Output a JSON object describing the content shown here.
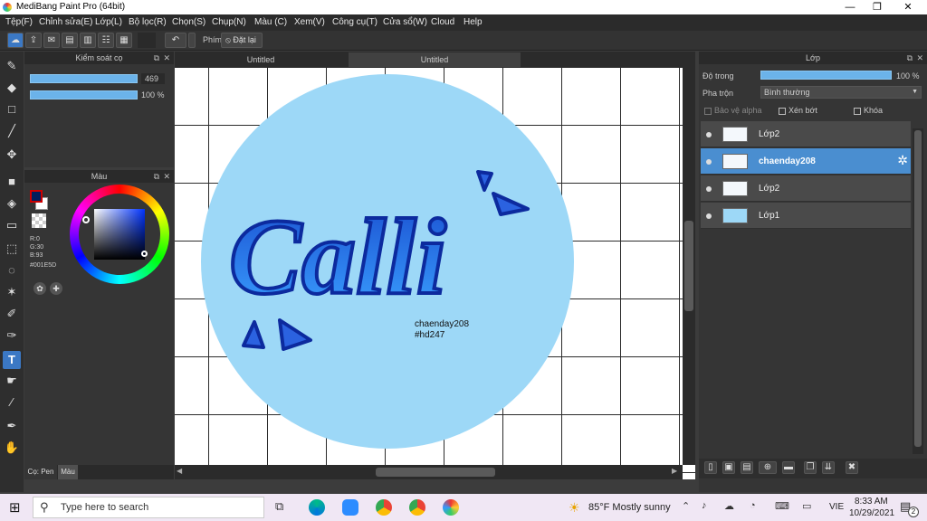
{
  "window": {
    "title": "MediBang Paint Pro (64bit)",
    "min": "—",
    "max": "❐",
    "close": "✕"
  },
  "menu": [
    "Tệp(F)",
    "Chỉnh sửa(E)",
    "Lớp(L)",
    "Bộ lọc(R)",
    "Chọn(S)",
    "Chụp(N)",
    "Màu (C)",
    "Xem(V)",
    "Công cụ(T)",
    "Cửa sổ(W)",
    "Cloud",
    "Help"
  ],
  "toolbar": {
    "key_label": "Phím",
    "reset_label": "Đặt lại"
  },
  "brush_panel": {
    "title": "Kiểm soát cọ",
    "size_value": "469",
    "opacity_value": "100 %"
  },
  "color_panel": {
    "title": "Màu",
    "r": "R:0",
    "g": "G:30",
    "b": "B:93",
    "hex": "#001E5D",
    "primary_color": "#001E5D"
  },
  "left_tabs": {
    "pen": "Cọ: Pen",
    "color": "Màu"
  },
  "tabs": [
    "Untitled",
    "Untitled"
  ],
  "artwork": {
    "word": "Calli",
    "signature_line1": "chaenday208",
    "signature_line2": "#hd247"
  },
  "layer_panel": {
    "title": "Lớp",
    "opacity_label": "Độ trong",
    "opacity_value": "100 %",
    "blend_label": "Pha trộn",
    "blend_value": "Bình thường",
    "protect_alpha": "Bảo vệ alpha",
    "clip": "Xén bớt",
    "lock": "Khóa",
    "layers": [
      {
        "name": "Lớp2",
        "selected": false
      },
      {
        "name": "chaenday208",
        "selected": true
      },
      {
        "name": "Lớp2",
        "selected": false
      },
      {
        "name": "Lớp1",
        "selected": false
      }
    ]
  },
  "taskbar": {
    "search_placeholder": "Type here to search",
    "weather": "85°F  Mostly sunny",
    "lang": "VIE",
    "time": "8:33 AM",
    "date": "10/29/2021",
    "notif_count": "2"
  }
}
